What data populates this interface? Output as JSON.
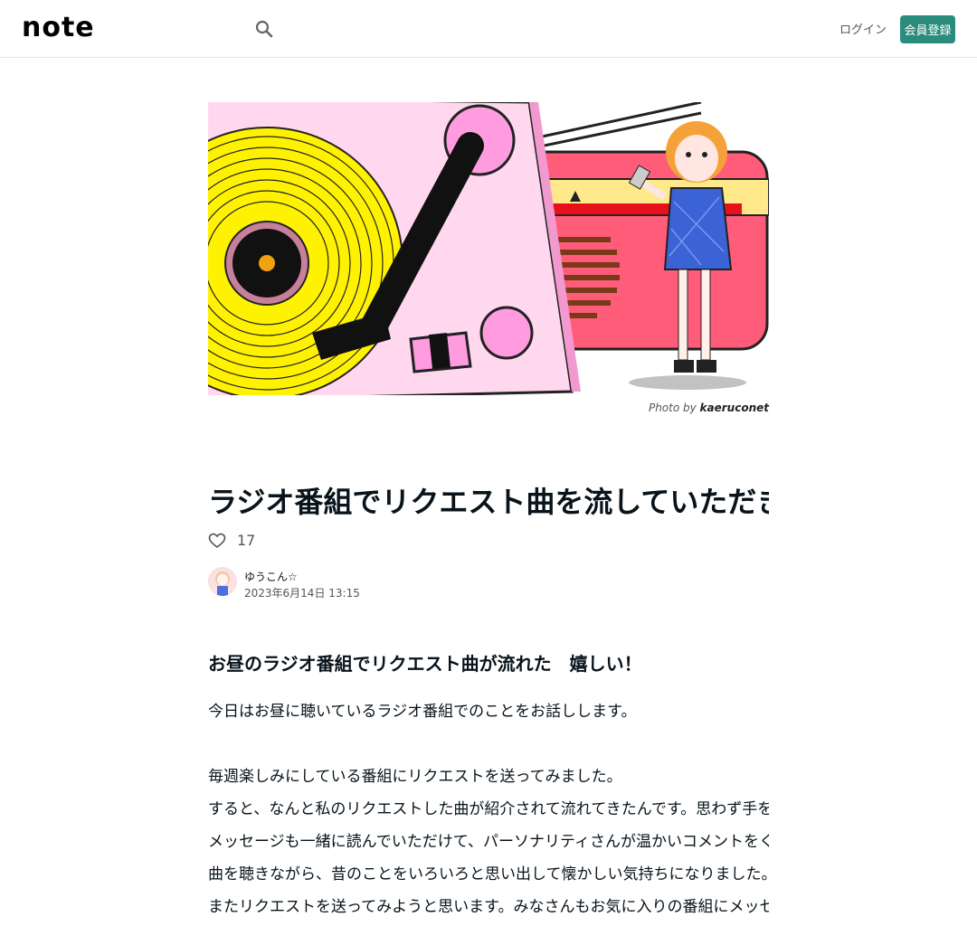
{
  "header": {
    "logo_text": "note",
    "login_label": "ログイン",
    "signup_label": "会員登録"
  },
  "hero": {
    "credit_prefix": "Photo by",
    "credit_author": "kaeruconet"
  },
  "article": {
    "title": "ラジオ番組でリクエスト曲を流していただきました！",
    "like_count": "17",
    "author_name": "ゆうこん☆",
    "date": "2023年6月14日 13:15",
    "heading": "お昼のラジオ番組でリクエスト曲が流れた　嬉しい！",
    "paragraphs": [
      "今日はお昼に聴いているラジオ番組でのことをお話しします。",
      "",
      "毎週楽しみにしている番組にリクエストを送ってみました。",
      "すると、なんと私のリクエストした曲が紹介されて流れてきたんです。思わず手を止めてラジオの前でじっと聴き入ってしまいました。",
      "メッセージも一緒に読んでいただけて、パーソナリティさんが温かいコメントをくださいました。本当に嬉しかったです。",
      "曲を聴きながら、昔のことをいろいろと思い出して懐かしい気持ちになりました。",
      "またリクエストを送ってみようと思います。みなさんもお気に入りの番組にメッセージを送ってみてはいかがでしょうか。きっと楽しいですよ。"
    ]
  },
  "colors": {
    "brand": "#2a8c7d",
    "text": "#08131a",
    "muted": "#555555"
  },
  "icons": [
    "search-icon",
    "heart-icon"
  ]
}
